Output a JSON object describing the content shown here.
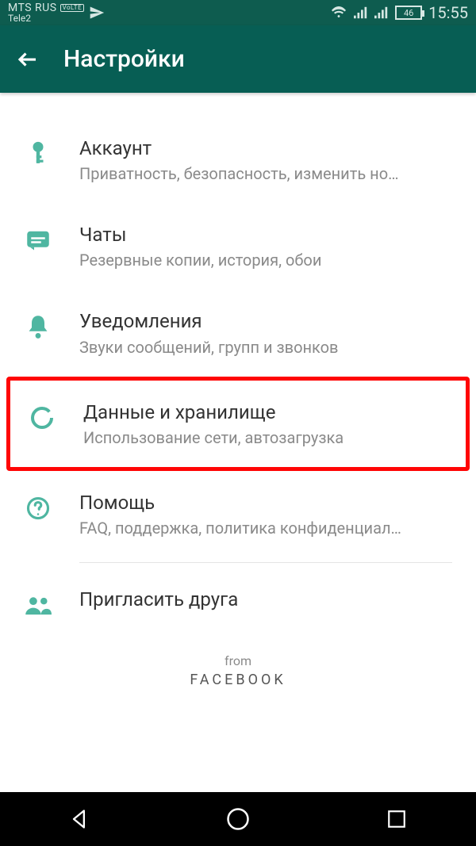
{
  "status": {
    "carrier_top": "MTS RUS",
    "carrier_volte": "VoLTE",
    "carrier_sub": "Tele2",
    "battery": "46",
    "time": "15:55"
  },
  "header": {
    "title": "Настройки"
  },
  "items": [
    {
      "title": "Аккаунт",
      "sub": "Приватность, безопасность, изменить но…"
    },
    {
      "title": "Чаты",
      "sub": "Резервные копии, история, обои"
    },
    {
      "title": "Уведомления",
      "sub": "Звуки сообщений, групп и звонков"
    },
    {
      "title": "Данные и хранилище",
      "sub": "Использование сети, автозагрузка"
    },
    {
      "title": "Помощь",
      "sub": "FAQ, поддержка, политика конфиденциал…"
    },
    {
      "title": "Пригласить друга",
      "sub": ""
    }
  ],
  "footer": {
    "from": "from",
    "brand": "FACEBOOK"
  }
}
